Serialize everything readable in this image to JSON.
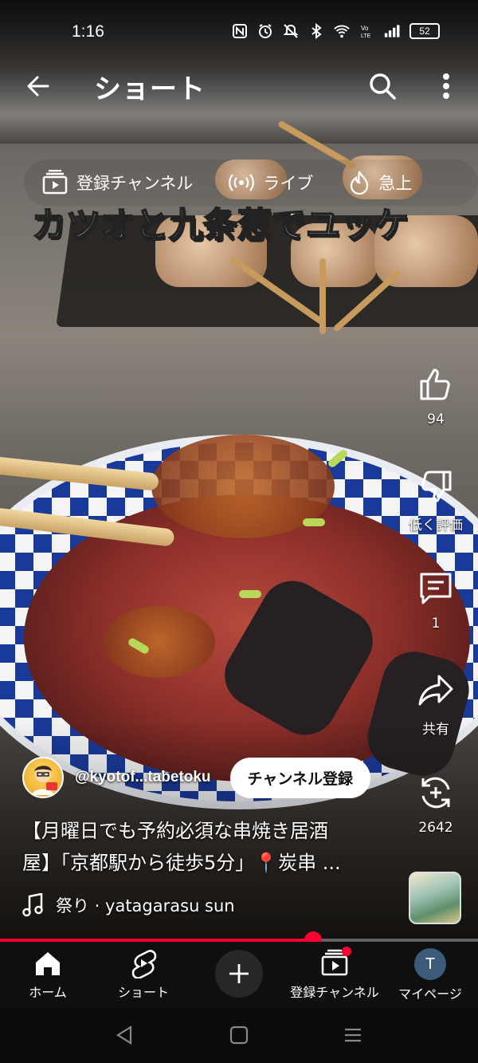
{
  "status_bar": {
    "time": "1:16",
    "battery": "52"
  },
  "top_bar": {
    "title": "ショート"
  },
  "chips": [
    {
      "icon": "subscriptions-icon",
      "label": "登録チャンネル"
    },
    {
      "icon": "live-icon",
      "label": "ライブ"
    },
    {
      "icon": "trending-icon",
      "label": "急上"
    }
  ],
  "video": {
    "overlay_caption": "カツオと九条葱でユッケ"
  },
  "actions": {
    "like_count": "94",
    "dislike_label": "低く評価",
    "comment_count": "1",
    "share_label": "共有",
    "remix_count": "2642"
  },
  "channel": {
    "handle": "@kyotof...tabetoku",
    "subscribe_label": "チャンネル登録"
  },
  "description": {
    "line1": "【月曜日でも予約必須な串焼き居酒",
    "line2": "屋】「京都駅から徒歩5分」📍炭串 ..."
  },
  "music": {
    "text": "祭り · yatagarasu sun"
  },
  "progress": {
    "fraction": 0.655
  },
  "bottom_nav": {
    "home": "ホーム",
    "shorts": "ショート",
    "subscriptions": "登録チャンネル",
    "me": "マイページ",
    "avatar_letter": "T"
  },
  "colors": {
    "accent": "#ff0033",
    "nav_bg": "#0f0f0f"
  }
}
